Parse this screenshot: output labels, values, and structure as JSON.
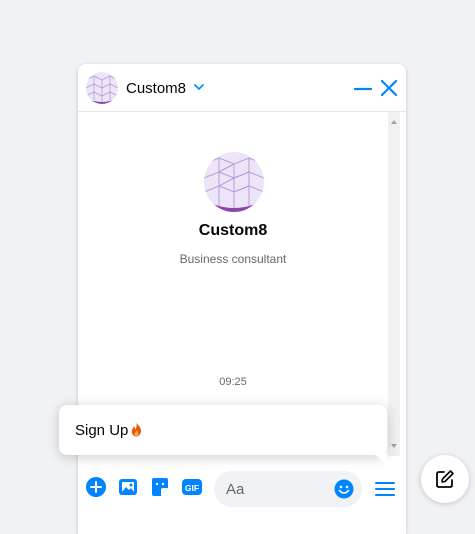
{
  "colors": {
    "accent": "#0084ff",
    "avatar_purple": "#9b59d0",
    "secondary_text": "#65676b"
  },
  "header": {
    "title": "Custom8",
    "icons": [
      "avatar",
      "chevron-down-icon",
      "minimize-icon",
      "close-icon"
    ]
  },
  "conversation": {
    "profile_name": "Custom8",
    "profile_subtitle": "Business consultant",
    "timestamp": "09:25"
  },
  "popup": {
    "text": "Sign Up",
    "icon": "fire-icon"
  },
  "composer": {
    "placeholder": "Aa",
    "icons": [
      "plus-circle-icon",
      "image-icon",
      "sticker-icon",
      "gif-icon",
      "emoji-icon",
      "menu-icon"
    ]
  },
  "fab": {
    "icon": "compose-icon"
  }
}
